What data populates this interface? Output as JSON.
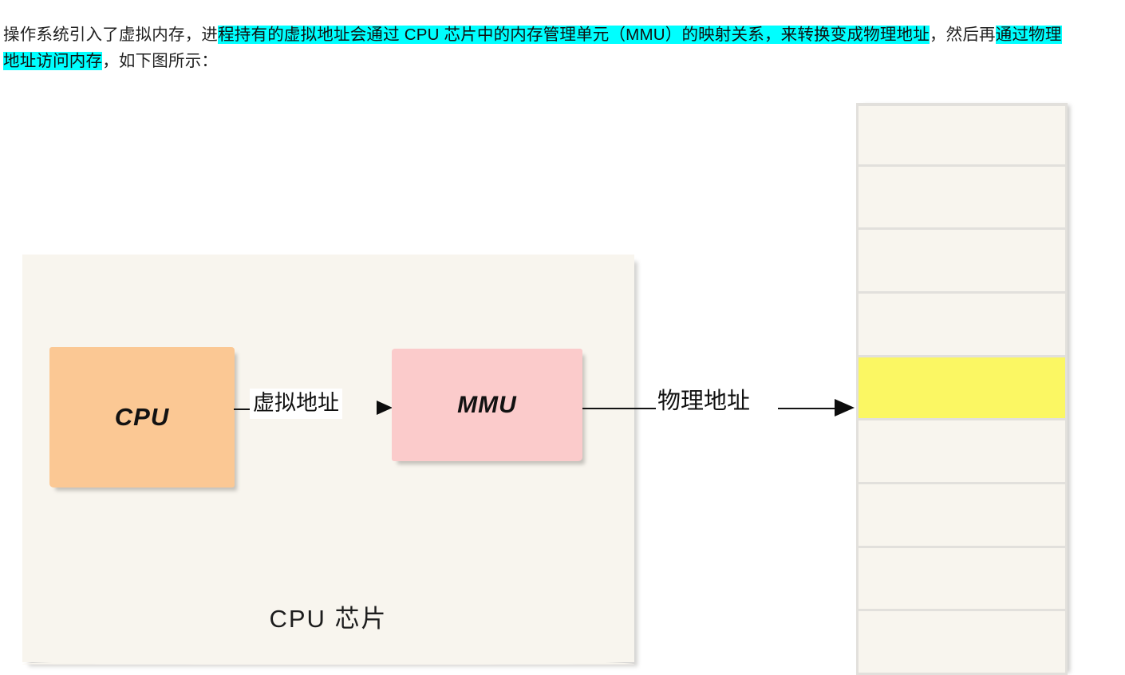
{
  "paragraph": {
    "segments": [
      {
        "text": "操作系统引入了虚拟内存，进",
        "highlight": false
      },
      {
        "text": "程持有的虚拟地址会通过 CPU 芯片中的内存管理单元（MMU）的映射关系，来转换变成物理地址",
        "highlight": true
      },
      {
        "text": "，然后再",
        "highlight": false
      },
      {
        "text": "通过物理地址访问内存",
        "highlight": true
      },
      {
        "text": "，如下图所示：",
        "highlight": false
      }
    ],
    "highlight_color": "#00FFFF"
  },
  "diagram": {
    "panel": {
      "caption": "CPU 芯片",
      "fill": "#F8F5EE"
    },
    "nodes": [
      {
        "label": "CPU",
        "fill": "#FBC894"
      },
      {
        "label": "MMU",
        "fill": "#FBCBCB"
      }
    ],
    "connectors": [
      {
        "label": "虚拟地址",
        "from": "CPU",
        "to": "MMU"
      },
      {
        "label": "物理地址",
        "from": "MMU",
        "to": "memory"
      }
    ],
    "memory": {
      "fill": "#F8F5EE",
      "highlight_fill": "#FBF763",
      "divider_color": "#E2E0DC",
      "cells": [
        {
          "highlight": false
        },
        {
          "highlight": false
        },
        {
          "highlight": false
        },
        {
          "highlight": false
        },
        {
          "highlight": true
        },
        {
          "highlight": false
        },
        {
          "highlight": false
        },
        {
          "highlight": false
        },
        {
          "highlight": false
        }
      ]
    }
  }
}
